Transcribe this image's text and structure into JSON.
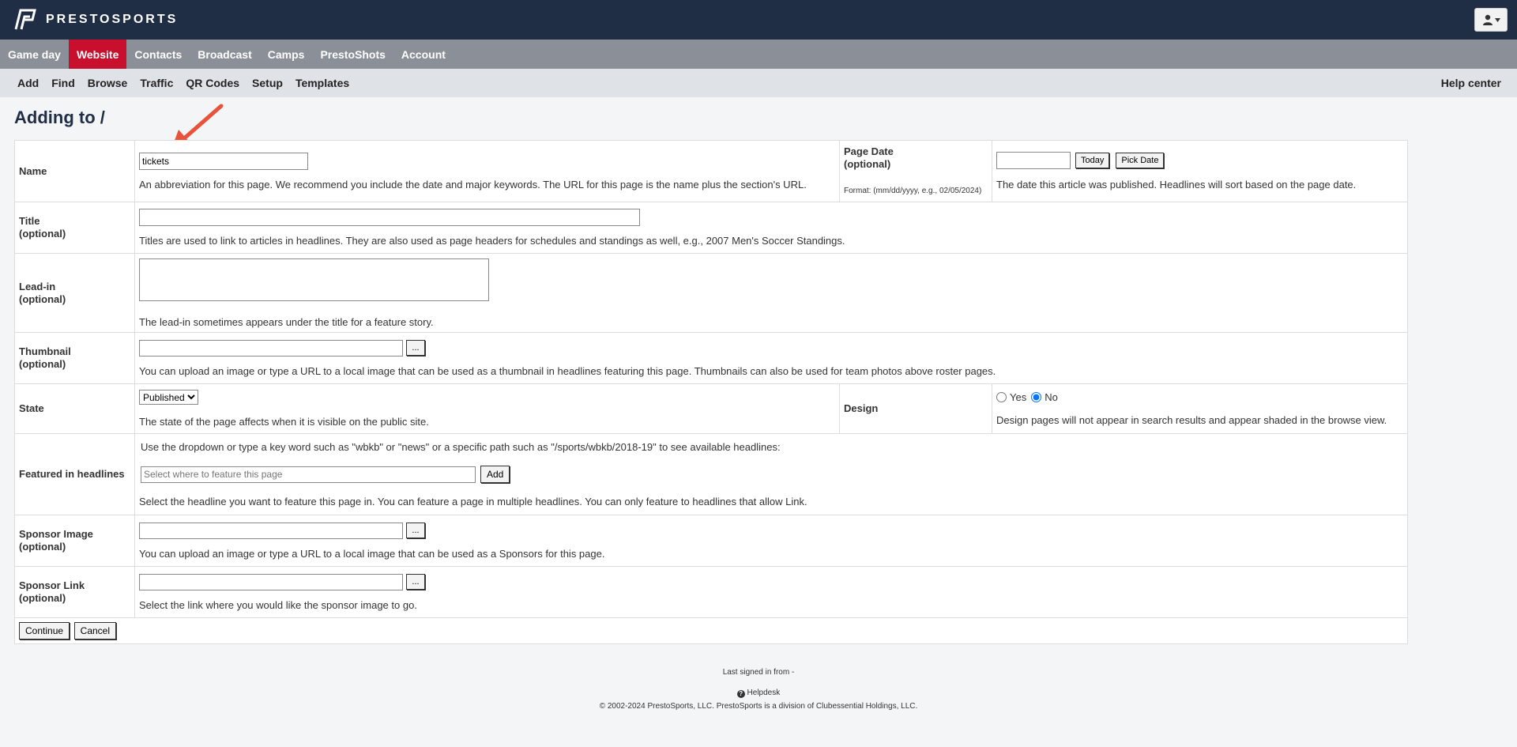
{
  "header": {
    "brand": "PRESTOSPORTS",
    "user_icon": "user-icon"
  },
  "main_nav": [
    {
      "label": "Game day",
      "active": false
    },
    {
      "label": "Website",
      "active": true
    },
    {
      "label": "Contacts",
      "active": false
    },
    {
      "label": "Broadcast",
      "active": false
    },
    {
      "label": "Camps",
      "active": false
    },
    {
      "label": "PrestoShots",
      "active": false
    },
    {
      "label": "Account",
      "active": false
    }
  ],
  "sub_nav": {
    "items": [
      "Add",
      "Find",
      "Browse",
      "Traffic",
      "QR Codes",
      "Setup",
      "Templates"
    ],
    "help": "Help center"
  },
  "page_title": "Adding to /",
  "form": {
    "name": {
      "label": "Name",
      "value": "tickets",
      "help": "An abbreviation for this page. We recommend you include the date and major keywords. The URL for this page is the name plus the section's URL."
    },
    "page_date": {
      "label": "Page Date",
      "optional": "(optional)",
      "format": "Format: (mm/dd/yyyy, e.g., 02/05/2024)",
      "value": "",
      "today_label": "Today",
      "pick_label": "Pick Date",
      "help": "The date this article was published. Headlines will sort based on the page date."
    },
    "title": {
      "label": "Title",
      "optional": "(optional)",
      "value": "",
      "help": "Titles are used to link to articles in headlines. They are also used as page headers for schedules and standings as well, e.g., 2007 Men's Soccer Standings."
    },
    "leadin": {
      "label": "Lead-in",
      "optional": "(optional)",
      "value": "",
      "help": "The lead-in sometimes appears under the title for a feature story."
    },
    "thumbnail": {
      "label": "Thumbnail",
      "optional": "(optional)",
      "value": "",
      "browse_label": "...",
      "help": "You can upload an image or type a URL to a local image that can be used as a thumbnail in headlines featuring this page. Thumbnails can also be used for team photos above roster pages."
    },
    "state": {
      "label": "State",
      "selected": "Published",
      "help": "The state of the page affects when it is visible on the public site."
    },
    "design": {
      "label": "Design",
      "yes_label": "Yes",
      "no_label": "No",
      "selected": "No",
      "help": "Design pages will not appear in search results and appear shaded in the browse view."
    },
    "featured": {
      "label": "Featured in headlines",
      "intro": "Use the dropdown or type a key word such as \"wbkb\" or \"news\" or a specific path such as \"/sports/wbkb/2018-19\" to see available headlines:",
      "placeholder": "Select where to feature this page",
      "add_label": "Add",
      "help": "Select the headline you want to feature this page in. You can feature a page in multiple headlines. You can only feature to headlines that allow Link."
    },
    "sponsor_image": {
      "label": "Sponsor Image",
      "optional": "(optional)",
      "value": "",
      "browse_label": "...",
      "help": "You can upload an image or type a URL to a local image that can be used as a Sponsors for this page."
    },
    "sponsor_link": {
      "label": "Sponsor Link",
      "optional": "(optional)",
      "value": "",
      "browse_label": "...",
      "help": "Select the link where you would like the sponsor image to go."
    },
    "continue_label": "Continue",
    "cancel_label": "Cancel"
  },
  "footer": {
    "last_signed": "Last signed in from -",
    "helpdesk": "Helpdesk",
    "copyright": "© 2002-2024 PrestoSports, LLC. PrestoSports is a division of Clubessential Holdings, LLC."
  },
  "colors": {
    "topbar": "#1f2d45",
    "mainnav": "#8a8f98",
    "active_tab": "#c8102e",
    "subnav": "#dfe2e7",
    "annotation_arrow": "#e8513a"
  }
}
